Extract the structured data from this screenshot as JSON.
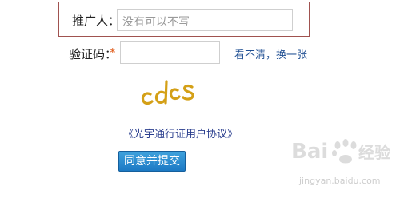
{
  "form": {
    "referrer_label": "推广人：",
    "referrer_placeholder": "没有可以不写",
    "captcha_label": "验证码：",
    "required_mark": "*",
    "captcha_refresh_link": "看不清，换一张",
    "captcha_text": "cdcs",
    "agreement_link": "《光宇通行证用户协议》",
    "submit_label": "同意并提交"
  },
  "watermark": {
    "text": "Baidu 经验",
    "url": "jingyan.baidu.com"
  },
  "colors": {
    "highlight_border": "#a0524f",
    "required": "#e05a18",
    "link": "#1f4f93",
    "button": "#1c79c4",
    "captcha_glyph": "#d4a017"
  }
}
